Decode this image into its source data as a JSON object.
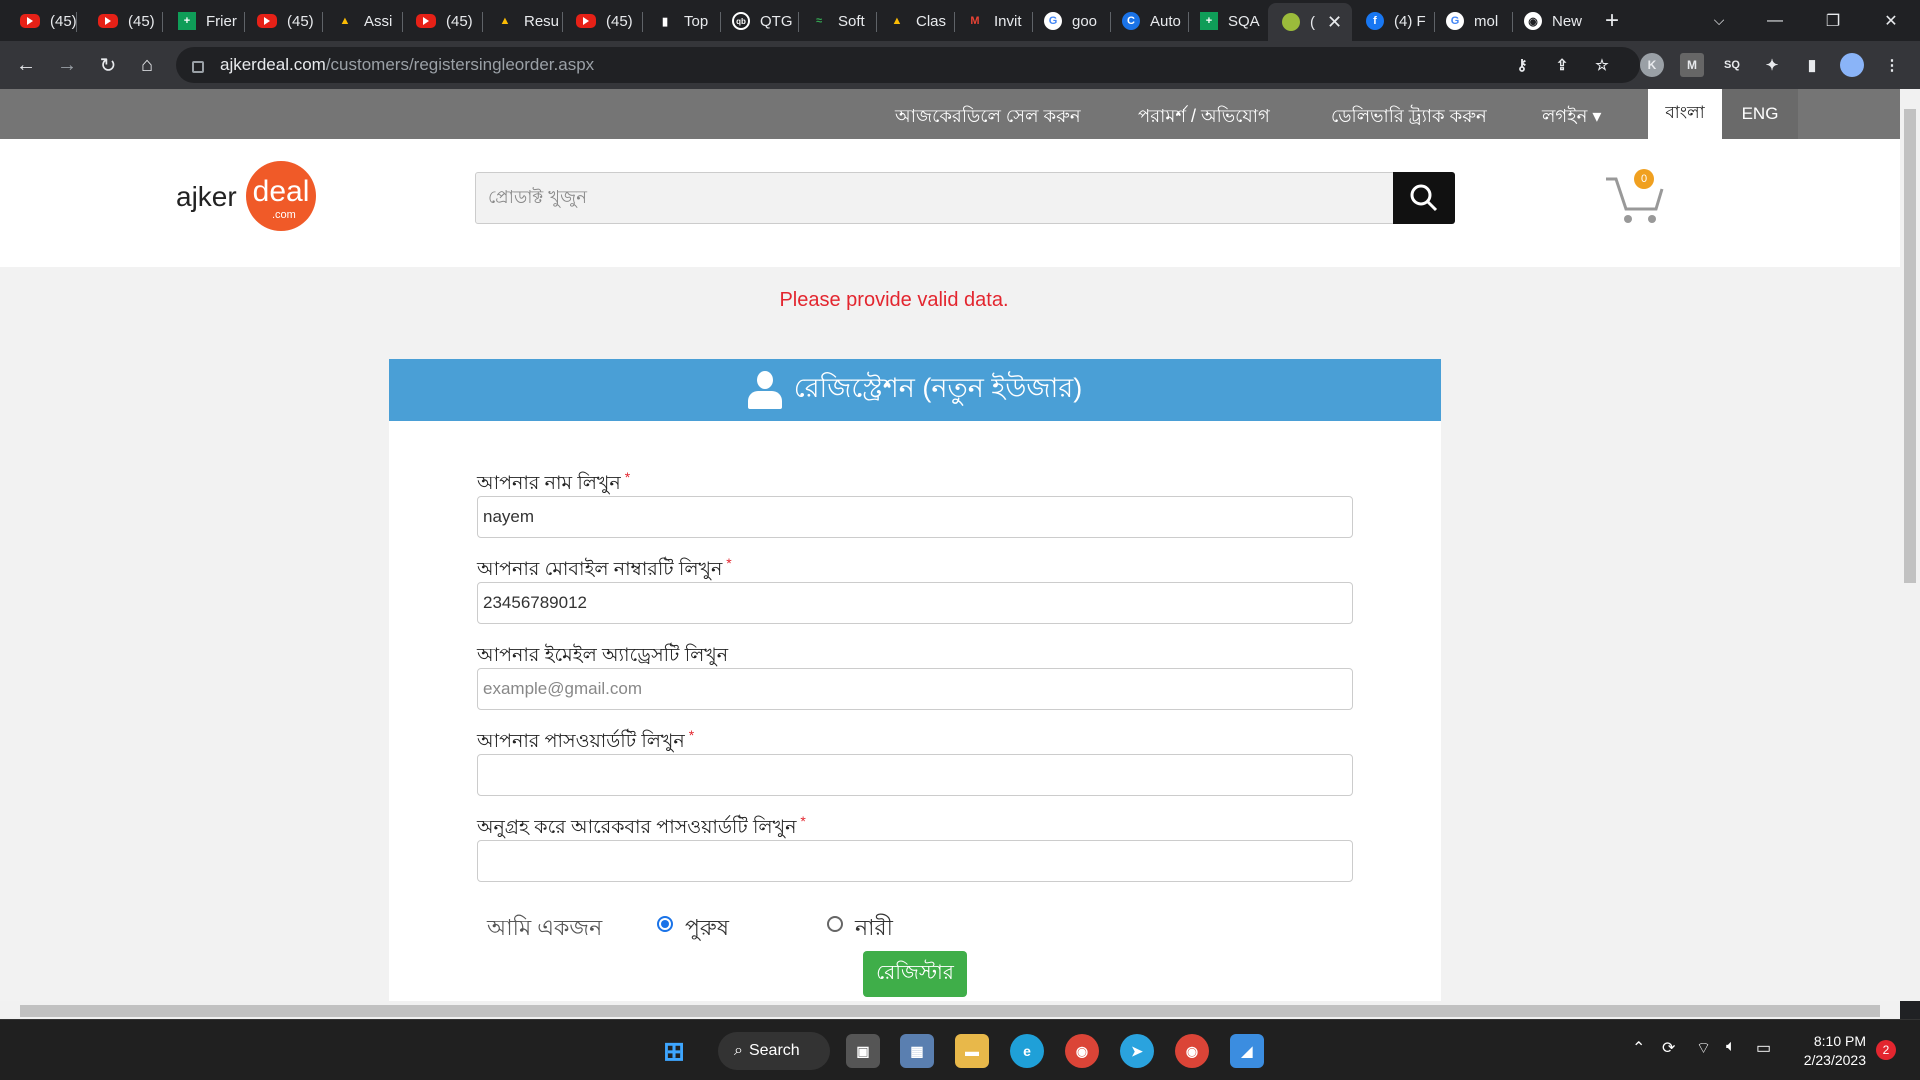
{
  "browser": {
    "tabs": [
      {
        "label": "(45)",
        "icon": "youtube-icon"
      },
      {
        "label": "(45)",
        "icon": "youtube-icon"
      },
      {
        "label": "Frier",
        "icon": "google-sheets-icon"
      },
      {
        "label": "(45)",
        "icon": "youtube-icon"
      },
      {
        "label": "Assi",
        "icon": "google-drive-icon"
      },
      {
        "label": "(45)",
        "icon": "youtube-icon"
      },
      {
        "label": "Resu",
        "icon": "google-drive-icon"
      },
      {
        "label": "(45)",
        "icon": "youtube-icon"
      },
      {
        "label": "Top",
        "icon": "tophat-icon"
      },
      {
        "label": "QTG",
        "icon": "qtg-icon"
      },
      {
        "label": "Soft",
        "icon": "software-icon"
      },
      {
        "label": "Clas",
        "icon": "google-drive-icon"
      },
      {
        "label": "Invit",
        "icon": "gmail-icon"
      },
      {
        "label": "goo",
        "icon": "google-icon"
      },
      {
        "label": "Auto",
        "icon": "c-icon"
      },
      {
        "label": "SQA",
        "icon": "google-sheets-icon"
      },
      {
        "label": "(",
        "icon": "ajkerdeal-icon",
        "active": true
      },
      {
        "label": "(4) F",
        "icon": "facebook-icon"
      },
      {
        "label": "mol",
        "icon": "google-icon"
      },
      {
        "label": "New",
        "icon": "chrome-icon"
      }
    ],
    "url_host": "ajkerdeal.com",
    "url_path": "/customers/registersingleorder.aspx"
  },
  "topnav": {
    "items": [
      "আজকেরডিলে সেল করুন",
      "পরামর্শ / অভিযোগ",
      "ডেলিভারি ট্র্যাক করুন",
      "লগইন ▾"
    ],
    "lang_bn": "বাংলা",
    "lang_en": "ENG"
  },
  "header": {
    "logo_text_left": "ajker",
    "logo_text_right": "deal",
    "logo_text_com": ".com",
    "search_placeholder": "প্রোডাক্ট খুজুন",
    "cart_count": "0"
  },
  "error_message": "Please provide valid data.",
  "form": {
    "title": "রেজিস্ট্রেশন (নতুন ইউজার)",
    "fields": [
      {
        "label": "আপনার নাম লিখুন",
        "required": "*",
        "value": "nayem",
        "placeholder": ""
      },
      {
        "label": "আপনার মোবাইল নাম্বারটি লিখুন",
        "required": "*",
        "value": "23456789012",
        "placeholder": ""
      },
      {
        "label": "আপনার ইমেইল অ্যাড্রেসটি লিখুন",
        "required": "",
        "value": "",
        "placeholder": "example@gmail.com"
      },
      {
        "label": "আপনার পাসওয়ার্ডটি লিখুন",
        "required": "*",
        "value": "",
        "placeholder": ""
      },
      {
        "label": "অনুগ্রহ করে আরেকবার পাসওয়ার্ডটি লিখুন",
        "required": "*",
        "value": "",
        "placeholder": ""
      }
    ],
    "gender_label": "আমি একজন",
    "gender_options": [
      "পুরুষ",
      "নারী"
    ],
    "gender_selected": "পুরুষ",
    "submit_label": "রেজিস্টার"
  },
  "taskbar": {
    "search_label": "Search",
    "time": "8:10 PM",
    "date": "2/23/2023",
    "notification_count": "2"
  },
  "colors": {
    "header_blue": "#4a9fd6",
    "submit_green": "#3fae49",
    "error_red": "#e3262f",
    "logo_orange": "#f05a28",
    "nav_grey": "#757575"
  }
}
